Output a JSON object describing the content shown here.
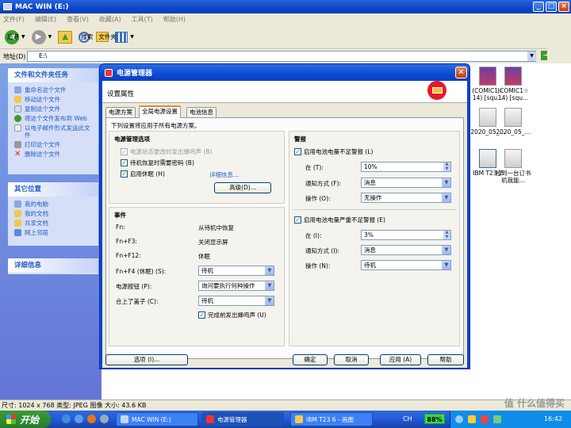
{
  "explorer": {
    "title": "MAC WIN (E:)",
    "menu": [
      "文件(F)",
      "编辑(E)",
      "查看(V)",
      "收藏(A)",
      "工具(T)",
      "帮助(H)"
    ],
    "toolbar": {
      "back": "后退",
      "search": "搜索",
      "folders": "文件夹"
    },
    "address_label": "地址(D)",
    "address_value": "E:\\",
    "go_label": "转到",
    "file_tasks": {
      "heading": "文件和文件夹任务",
      "items": [
        "重命名这个文件",
        "移动这个文件",
        "复制这个文件",
        "将这个文件发布到 Web",
        "以电子邮件形式发送此文件",
        "打印这个文件",
        "删除这个文件"
      ]
    },
    "other_places": {
      "heading": "其它位置",
      "items": [
        "我的电脑",
        "我的文档",
        "共享文档",
        "网上邻居"
      ]
    },
    "details": {
      "heading": "详细信息"
    },
    "files": [
      "(COMIC1☆ 14) [squ...",
      "(COMIC1☆ 14) [squ...",
      "2020_05_...",
      "2020_05_...",
      "IBM T23 2",
      "拾到一台订书机我能..."
    ],
    "status_bar": "尺寸: 1024 x 768 类型: JPEG 图像 大小: 43.6 KB",
    "status_right": "值 什么值得买"
  },
  "taskbar": {
    "start": "开始",
    "tasks": [
      "MAC WIN (E:)",
      "电源管理器",
      "IBM T23 6 - 画图"
    ],
    "lang": "CH",
    "battery": "88%",
    "clock": "16:42"
  },
  "dialog": {
    "title": "电源管理器",
    "header": "设置属性",
    "tabs": [
      "电源方案",
      "全局电源设置",
      "电池信息"
    ],
    "description": "下列设置将应用于所有电源方案。",
    "power_options": {
      "heading": "电源管理选项",
      "checkboxes": [
        {
          "label": "电源状态更改时发出蜂鸣声 (B)",
          "checked": true,
          "enabled": false
        },
        {
          "label": "待机恢复时需要密码 (B)",
          "checked": true,
          "enabled": true
        },
        {
          "label": "启用休眠 (H)",
          "checked": true,
          "enabled": true
        }
      ],
      "details_link": "详细信息...",
      "advanced_button": "高级(D)..."
    },
    "events": {
      "heading": "事件",
      "rows": [
        {
          "label": "Fn:",
          "value": "从待机中恢复"
        },
        {
          "label": "Fn+F3:",
          "value": "关闭显示屏"
        },
        {
          "label": "Fn+F12:",
          "value": "休眠"
        }
      ],
      "selects": [
        {
          "label": "Fn+F4 (休眠) (S):",
          "value": "待机"
        },
        {
          "label": "电源按钮 (P):",
          "value": "询问要执行何种操作"
        },
        {
          "label": "合上了盖子 (C):",
          "value": "待机"
        }
      ],
      "beep_checkbox": "完成前发出蜂鸣声 (U)"
    },
    "alarms": {
      "heading": "警报",
      "low": {
        "checkbox": "启用电池电量不足警报 (L)",
        "at_label": "在 (T):",
        "at_value": "10%",
        "notify_label": "通知方式 (F):",
        "notify_value": "消息",
        "action_label": "操作 (O):",
        "action_value": "无操作"
      },
      "critical": {
        "checkbox": "启用电池电量严重不足警报 (E)",
        "at_label": "在 (I):",
        "at_value": "3%",
        "notify_label": "通知方式 (I):",
        "notify_value": "消息",
        "action_label": "操作 (N):",
        "action_value": "待机"
      }
    },
    "buttons": {
      "options": "选项 (I)...",
      "ok": "确定",
      "cancel": "取消",
      "apply": "应用 (A)",
      "help": "帮助"
    }
  },
  "colors": {
    "xp_blue": "#0a46c9",
    "taskpane": "#6375d6",
    "start_green": "#2f8a2f"
  }
}
